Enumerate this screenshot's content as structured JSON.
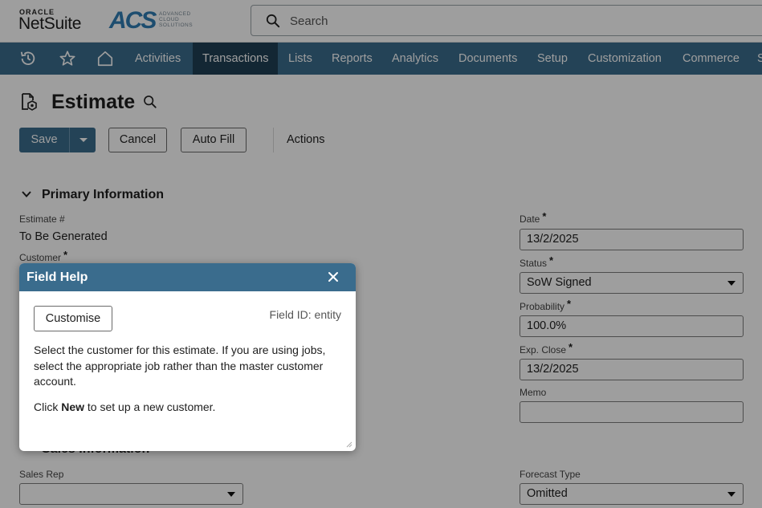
{
  "header": {
    "oracle_text": "ORACLE",
    "netsuite_text": "NetSuite",
    "acs_text": "ACS",
    "acs_sub": [
      "ADVANCED",
      "CLOUD",
      "SOLUTIONS"
    ],
    "search_placeholder": "Search"
  },
  "nav": {
    "items": [
      "Activities",
      "Transactions",
      "Lists",
      "Reports",
      "Analytics",
      "Documents",
      "Setup",
      "Customization",
      "Commerce",
      "S"
    ],
    "active": "Transactions"
  },
  "page": {
    "title": "Estimate",
    "buttons": {
      "save": "Save",
      "cancel": "Cancel",
      "autofill": "Auto Fill",
      "actions": "Actions"
    }
  },
  "primary": {
    "section_title": "Primary Information",
    "estimate_label": "Estimate #",
    "estimate_value": "To Be Generated",
    "customer_label": "Customer",
    "required_mark": "*",
    "date_label": "Date",
    "date_value": "13/2/2025",
    "status_label": "Status",
    "status_value": "SoW Signed",
    "probability_label": "Probability",
    "probability_value": "100.0%",
    "expclose_label": "Exp. Close",
    "expclose_value": "13/2/2025",
    "memo_label": "Memo",
    "memo_value": ""
  },
  "sales": {
    "section_title": "Sales Information",
    "salesrep_label": "Sales Rep",
    "salesrep_value": "",
    "forecast_label": "Forecast Type",
    "forecast_value": "Omitted"
  },
  "popup": {
    "title": "Field Help",
    "customise_label": "Customise",
    "field_id": "Field ID: entity",
    "body": "Select the customer for this estimate. If you are using jobs, select the appropriate job rather than the master customer account.",
    "body2_pre": "Click ",
    "body2_bold": "New",
    "body2_post": " to set up a new customer."
  },
  "colors": {
    "nav_bg": "#3a6c8d",
    "nav_active": "#1f3f55",
    "brand_blue": "#2f7db3"
  }
}
